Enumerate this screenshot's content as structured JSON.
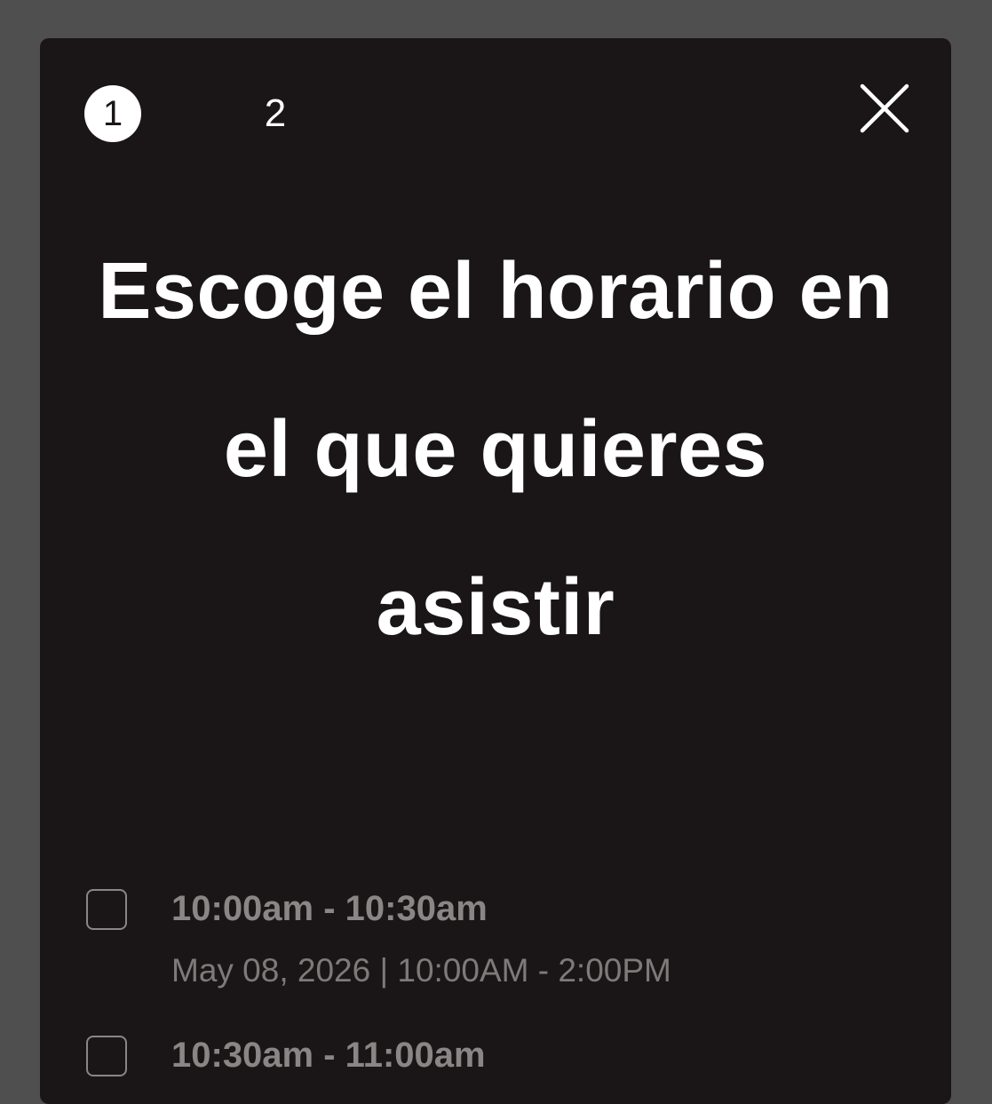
{
  "steps": {
    "active": "1",
    "inactive": "2"
  },
  "close": {
    "icon": "close-icon"
  },
  "title": "Escoge el horario en el que quieres asistir",
  "slots": [
    {
      "time": "10:00am - 10:30am",
      "detail": "May 08, 2026 | 10:00AM - 2:00PM",
      "checked": false
    },
    {
      "time": "10:30am - 11:00am",
      "checked": false
    }
  ],
  "colors": {
    "page_background": "#4f4f4f",
    "modal_background": "#1a1617",
    "text_primary": "#ffffff",
    "text_muted": "#8a8686"
  }
}
